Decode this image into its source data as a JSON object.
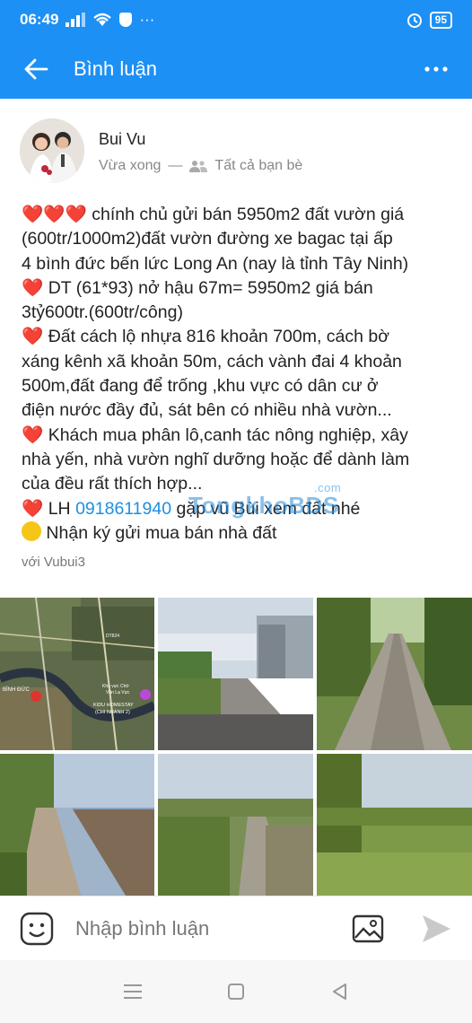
{
  "status_bar": {
    "time": "06:49",
    "battery": "95"
  },
  "header": {
    "title": "Bình luận"
  },
  "post": {
    "author": "Bui Vu",
    "time": "Vừa xong",
    "audience": "Tất cả bạn bè",
    "lines": {
      "l1": "chính chủ gửi bán 5950m2 đất vườn giá",
      "l2": "(600tr/1000m2)đất vườn đường xe bagac tại ấp",
      "l3": "4 bình đức bến lức Long An (nay là tỉnh Tây Ninh)",
      "l4": "DT (61*93) nở hậu 67m= 5950m2 giá bán",
      "l5": "3tỷ600tr.(600tr/công)",
      "l6": "Đất cách lộ nhựa 816 khoản 700m, cách bờ",
      "l7": "xáng kênh xã khoản 50m, cách vành đai 4 khoản",
      "l8": "500m,đất đang để trống ,khu vực có dân cư ở",
      "l9": "điện nước đầy đủ, sát bên có nhiều nhà vườn...",
      "l10": "Khách mua phân lô,canh tác nông nghiệp, xây",
      "l11": "nhà yến, nhà vườn nghĩ dưỡng hoặc để dành làm",
      "l12": "của đều rất thích hợp...",
      "l13_prefix": "LH",
      "phone": "0918611940",
      "l13_suffix": "gặp vũ Bùi xem đất nhé",
      "l14": "Nhận ký gửi mua bán nhà đất"
    },
    "tagged": "với Vubui3"
  },
  "watermark": {
    "main": "TongkhoBDS",
    "com": ".com"
  },
  "map": {
    "labels": [
      "Khu vực Chờ",
      "Văn Lạ Vực",
      "KIDU HOMESTAY",
      "(CHI NHÁNH 2)",
      "BÌNH ĐỨC",
      "DT824"
    ]
  },
  "comment": {
    "placeholder": "Nhập bình luận"
  },
  "colors": {
    "brand": "#1d90f5",
    "heart": "#d7261e",
    "link": "#1d8fe1"
  },
  "icons": [
    "back-arrow-icon",
    "more-dots-icon",
    "friends-icon",
    "sticker-icon",
    "image-icon",
    "send-icon",
    "menu-icon",
    "home-icon",
    "back-icon"
  ]
}
